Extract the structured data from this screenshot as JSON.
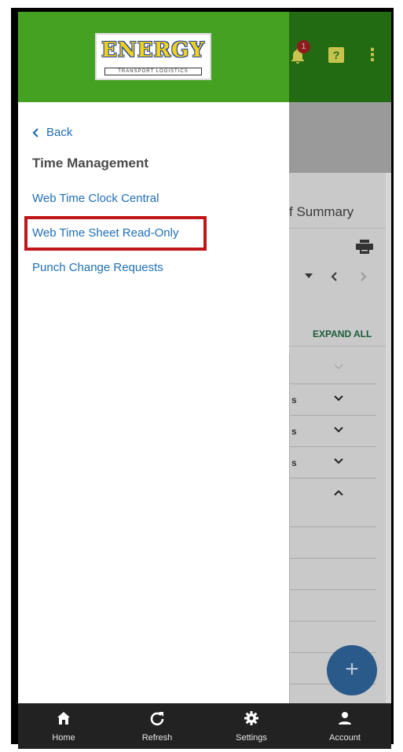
{
  "app": {
    "logo_main": "ENERGY",
    "logo_sub": "TRANSPORT LOGISTICS",
    "notification_count": "1",
    "help_icon": "?",
    "overflow_icon": "⋮"
  },
  "drawer": {
    "back_label": "Back",
    "section_title": "Time Management",
    "items": [
      {
        "label": "Web Time Clock Central"
      },
      {
        "label": "Web Time Sheet Read-Only"
      },
      {
        "label": "Punch Change Requests"
      }
    ]
  },
  "background": {
    "summary_title": "f Summary",
    "expand_all": "EXPAND ALL",
    "rows": [
      "s",
      "s",
      "s"
    ],
    "fab_label": "+"
  },
  "bottom_nav": [
    {
      "label": "Home",
      "icon": "home-icon"
    },
    {
      "label": "Refresh",
      "icon": "refresh-icon"
    },
    {
      "label": "Settings",
      "icon": "gear-icon"
    },
    {
      "label": "Account",
      "icon": "account-icon"
    }
  ],
  "colors": {
    "drawer_header": "#44a122",
    "link": "#1f6fb5",
    "highlight": "#c0161a",
    "bottom_nav": "#222222"
  }
}
